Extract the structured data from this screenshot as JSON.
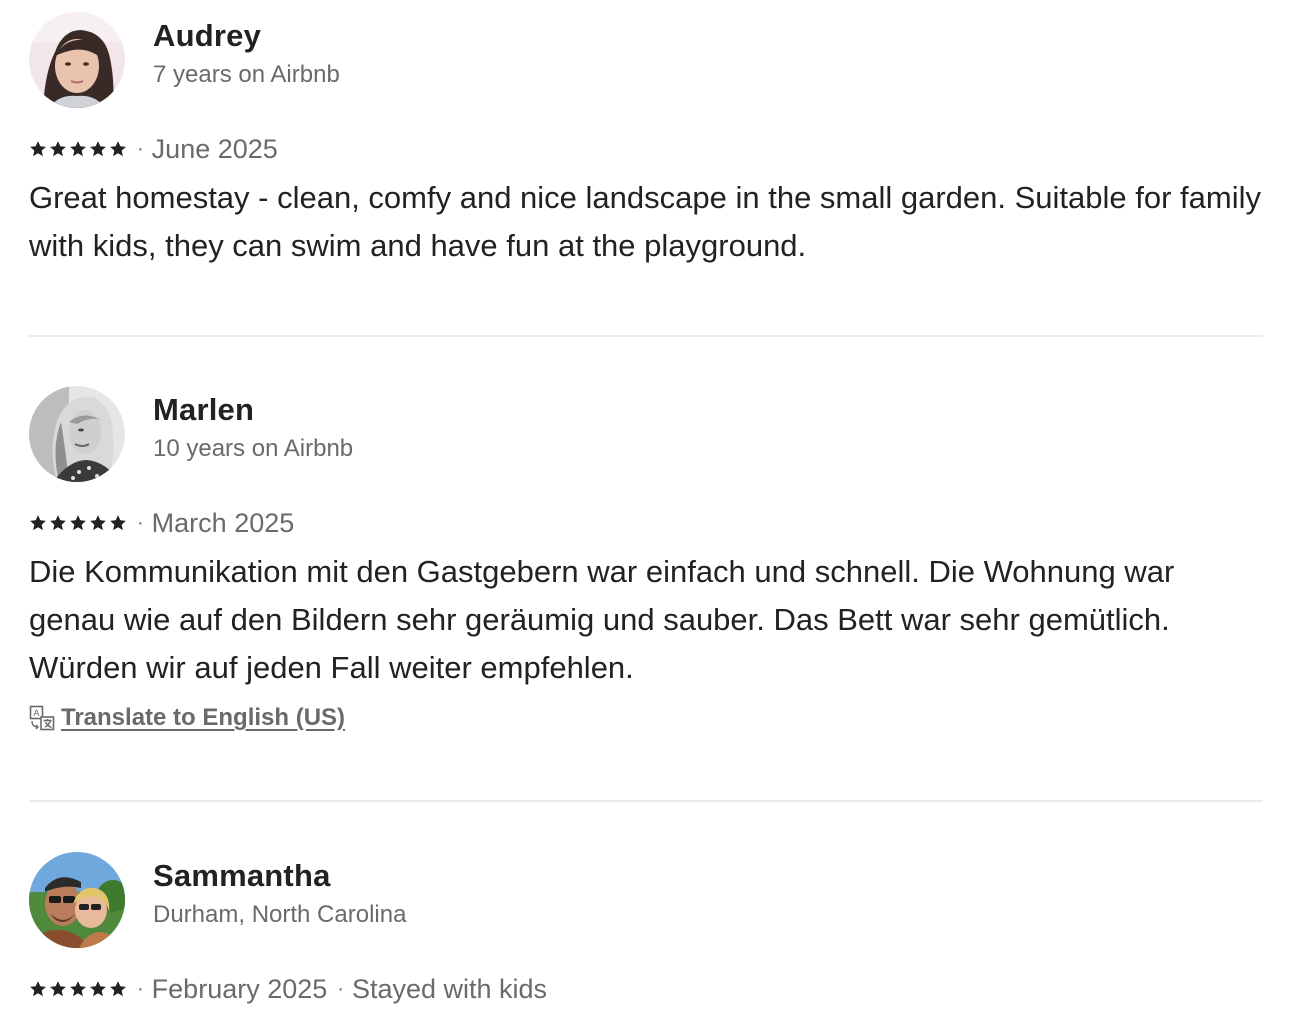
{
  "reviews": [
    {
      "name": "Audrey",
      "subtitle": "7 years on Airbnb",
      "rating": 5,
      "date": "June 2025",
      "trip": "",
      "text": "Great homestay - clean, comfy and  nice landscape in the small garden. Suitable for family with kids, they can swim and have fun at the playground.",
      "translate_label": ""
    },
    {
      "name": "Marlen",
      "subtitle": "10 years on Airbnb",
      "rating": 5,
      "date": "March 2025",
      "trip": "",
      "text": "Die Kommunikation mit den Gastgebern war einfach und schnell. Die Wohnung war genau wie auf den Bildern  sehr geräumig und sauber. Das Bett war sehr gemütlich. Würden wir auf jeden Fall weiter empfehlen.",
      "translate_label": "Translate to English (US)"
    },
    {
      "name": "Sammantha",
      "subtitle": "Durham, North Carolina",
      "rating": 5,
      "date": "February 2025",
      "trip": "Stayed with kids",
      "text": "",
      "translate_label": ""
    }
  ],
  "separator": "·",
  "icons": {
    "star": "star-icon",
    "translate": "translate-icon"
  },
  "colors": {
    "text_primary": "#222222",
    "text_secondary": "#6a6a6a",
    "divider": "#ebebeb"
  }
}
